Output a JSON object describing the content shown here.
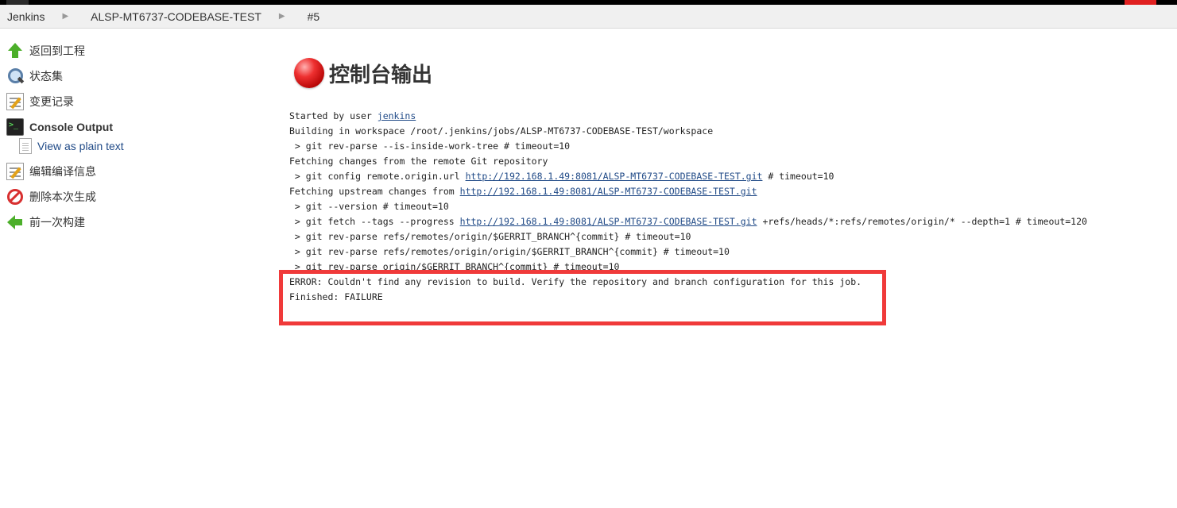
{
  "breadcrumb": {
    "items": [
      {
        "label": "Jenkins"
      },
      {
        "label": "ALSP-MT6737-CODEBASE-TEST"
      },
      {
        "label": "#5"
      }
    ],
    "separator": "▶"
  },
  "sidebar": {
    "items": [
      {
        "label": "返回到工程",
        "icon": "up-arrow-icon"
      },
      {
        "label": "状态集",
        "icon": "search-icon"
      },
      {
        "label": "变更记录",
        "icon": "notepad-icon"
      },
      {
        "label": "Console Output",
        "icon": "console-icon",
        "active": true
      },
      {
        "label": "View as plain text",
        "icon": "document-icon",
        "sub": true
      },
      {
        "label": "编辑编译信息",
        "icon": "notepad-icon"
      },
      {
        "label": "删除本次生成",
        "icon": "delete-icon"
      },
      {
        "label": "前一次构建",
        "icon": "back-arrow-icon"
      }
    ]
  },
  "main": {
    "title": "控制台输出",
    "status_color": "#ee3030",
    "console": {
      "l0_text": "Started by user ",
      "l0_link": "jenkins",
      "l1": "Building in workspace /root/.jenkins/jobs/ALSP-MT6737-CODEBASE-TEST/workspace",
      "l2": " > git rev-parse --is-inside-work-tree # timeout=10",
      "l3": "Fetching changes from the remote Git repository",
      "l4_pre": " > git config remote.origin.url ",
      "l4_link": "http://192.168.1.49:8081/ALSP-MT6737-CODEBASE-TEST.git",
      "l4_post": " # timeout=10",
      "l5_pre": "Fetching upstream changes from ",
      "l5_link": "http://192.168.1.49:8081/ALSP-MT6737-CODEBASE-TEST.git",
      "l6": " > git --version # timeout=10",
      "l7_pre": " > git fetch --tags --progress ",
      "l7_link": "http://192.168.1.49:8081/ALSP-MT6737-CODEBASE-TEST.git",
      "l7_post": " +refs/heads/*:refs/remotes/origin/* --depth=1 # timeout=120",
      "l8": " > git rev-parse refs/remotes/origin/$GERRIT_BRANCH^{commit} # timeout=10",
      "l9": " > git rev-parse refs/remotes/origin/origin/$GERRIT_BRANCH^{commit} # timeout=10",
      "l10": " > git rev-parse origin/$GERRIT_BRANCH^{commit} # timeout=10",
      "l11": "ERROR: Couldn't find any revision to build. Verify the repository and branch configuration for this job.",
      "l12": "Finished: FAILURE"
    }
  },
  "colors": {
    "highlight_border": "#f03a3a",
    "link": "#204a87"
  }
}
